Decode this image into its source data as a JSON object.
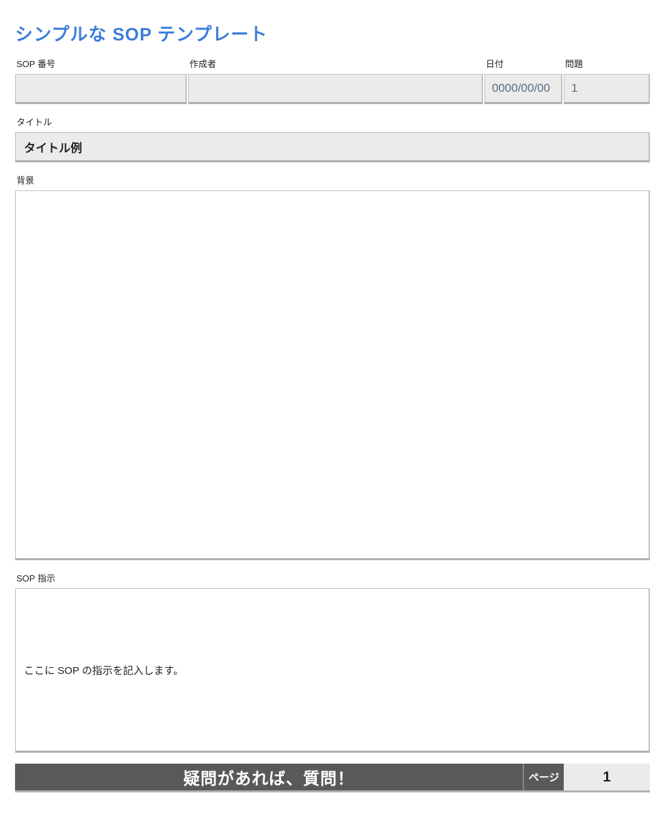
{
  "page_title": "シンプルな SOP テンプレート",
  "header": {
    "sop_no_label": "SOP 番号",
    "sop_no_value": "",
    "author_label": "作成者",
    "author_value": "",
    "date_label": "日付",
    "date_value": "0000/00/00",
    "issue_label": "問題",
    "issue_value": "1"
  },
  "title_section": {
    "label": "タイトル",
    "value": "タイトル例"
  },
  "background_section": {
    "label": "背景",
    "value": ""
  },
  "sop_instructions_section": {
    "label": "SOP 指示",
    "value": "ここに SOP の指示を記入します。"
  },
  "footer": {
    "message": "疑問があれば、質問！",
    "page_label": "ページ",
    "page_number": "1"
  }
}
